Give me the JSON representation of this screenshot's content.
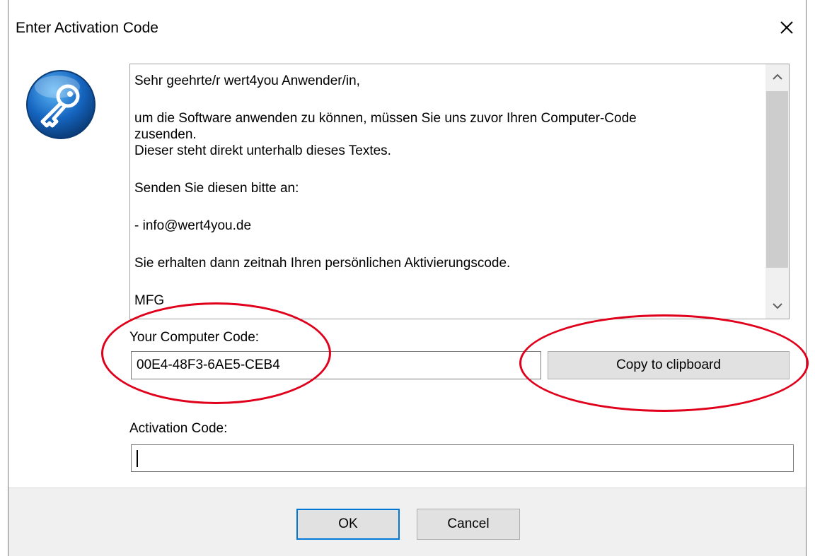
{
  "window": {
    "title": "Enter Activation Code"
  },
  "icons": {
    "close": "close-icon",
    "app": "key-icon",
    "scroll_up": "chevron-up-icon",
    "scroll_down": "chevron-down-icon"
  },
  "message": {
    "lines": [
      "Sehr geehrte/r wert4you Anwender/in,",
      "um die Software anwenden zu können, müssen Sie uns zuvor Ihren Computer-Code",
      "zusenden.",
      "Dieser steht direkt unterhalb dieses Textes.",
      "Senden Sie diesen bitte an:",
      "- info@wert4you.de",
      "Sie erhalten dann zeitnah Ihren persönlichen Aktivierungscode.",
      "MFG"
    ]
  },
  "computer_code": {
    "label": "Your Computer Code:",
    "value": "00E4-48F3-6AE5-CEB4",
    "copy_label": "Copy to clipboard"
  },
  "activation": {
    "label": "Activation Code:",
    "value": ""
  },
  "buttons": {
    "ok": "OK",
    "cancel": "Cancel"
  },
  "colors": {
    "annotation": "#e0001b",
    "accent": "#0078d7"
  }
}
